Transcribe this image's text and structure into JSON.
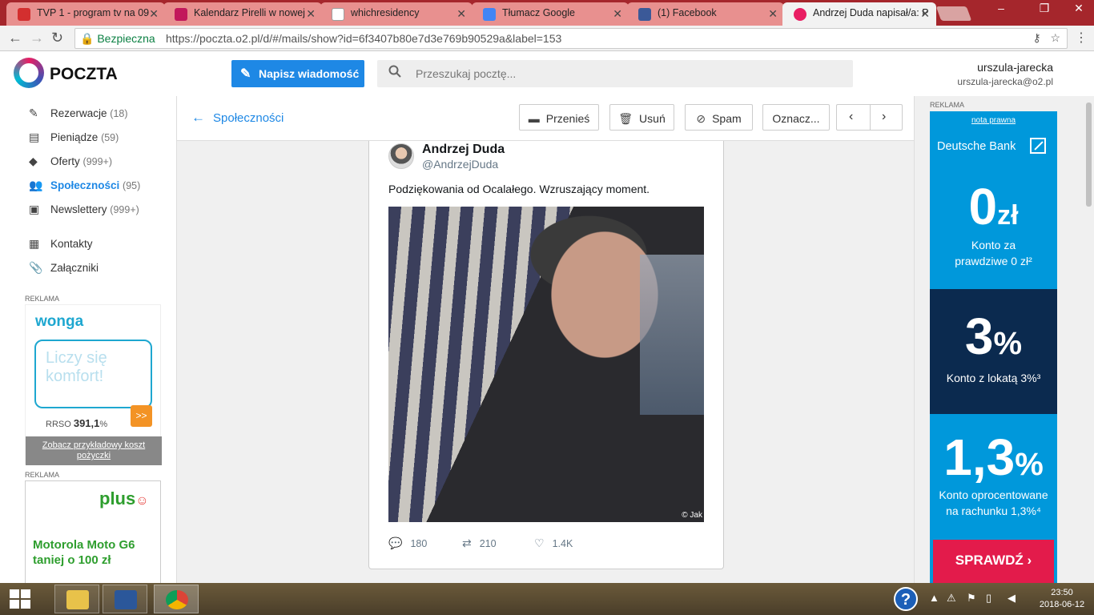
{
  "browser": {
    "tabs": [
      {
        "title": "TVP 1 - program tv na 09",
        "favicon_color": "#d32f2f"
      },
      {
        "title": "Kalendarz Pirelli w nowej",
        "favicon_color": "#c2185b"
      },
      {
        "title": "whichresidency",
        "favicon_color": "#9e9e9e"
      },
      {
        "title": "Tłumacz Google",
        "favicon_color": "#4285f4"
      },
      {
        "title": "(1) Facebook",
        "favicon_color": "#3b5998"
      },
      {
        "title": "Andrzej Duda napisał/a: P",
        "favicon_color": "#e91e63"
      }
    ],
    "security_label": "Bezpieczna",
    "url": "https://poczta.o2.pl/d/#/mails/show?id=6f3407b80e7d3e769b90529a&label=153"
  },
  "header": {
    "logo_text": "POCZTA",
    "compose_label": "Napisz wiadomość",
    "search_placeholder": "Przeszukaj pocztę...",
    "user_name": "urszula-jarecka",
    "user_email": "urszula-jarecka@o2.pl"
  },
  "sidebar": {
    "items": [
      {
        "label": "Rezerwacje",
        "count": "(18)",
        "icon": "edit-icon"
      },
      {
        "label": "Pieniądze",
        "count": "(59)",
        "icon": "money-icon"
      },
      {
        "label": "Oferty",
        "count": "(999+)",
        "icon": "tag-icon"
      },
      {
        "label": "Społeczności",
        "count": "(95)",
        "icon": "people-icon"
      },
      {
        "label": "Newslettery",
        "count": "(999+)",
        "icon": "newsletter-icon"
      },
      {
        "label": "Kontakty",
        "count": "",
        "icon": "contacts-icon"
      },
      {
        "label": "Załączniki",
        "count": "",
        "icon": "paperclip-icon"
      }
    ],
    "ad_label": "REKLAMA",
    "wonga": {
      "logo": "wonga",
      "bubble_text": "Liczy się komfort!",
      "rrso_label": "RRSO",
      "rrso_value": "391,1",
      "rrso_unit": "%",
      "go_label": ">>",
      "footer": "Zobacz przykładowy koszt pożyczki"
    },
    "plus": {
      "logo": "plus",
      "text": "Motorola Moto G6 taniej o 100 zł"
    }
  },
  "toolbar": {
    "back_label": "Społeczności",
    "move_label": "Przenieś",
    "delete_label": "Usuń",
    "spam_label": "Spam",
    "mark_label": "Oznacz..."
  },
  "tweet": {
    "name": "Andrzej Duda",
    "handle": "@AndrzejDuda",
    "text": "Podziękowania od Ocalałego. Wzruszający moment.",
    "photo_caption": "© Jak",
    "replies": "180",
    "retweets": "210",
    "likes": "1.4K"
  },
  "right_ad": {
    "label": "REKLAMA",
    "note": "nota prawna",
    "brand": "Deutsche Bank",
    "big1": "0",
    "big1_unit": "zł",
    "small1": "Konto za prawdziwe 0 zł²",
    "big2": "3",
    "big2_unit": "%",
    "small2": "Konto z lokatą 3%³",
    "big3": "1,3",
    "big3_unit": "%",
    "small3": "Konto oprocentowane na rachunku 1,3%⁴",
    "cta": "SPRAWDŹ"
  },
  "taskbar": {
    "time": "23:50",
    "date": "2018-06-12"
  }
}
